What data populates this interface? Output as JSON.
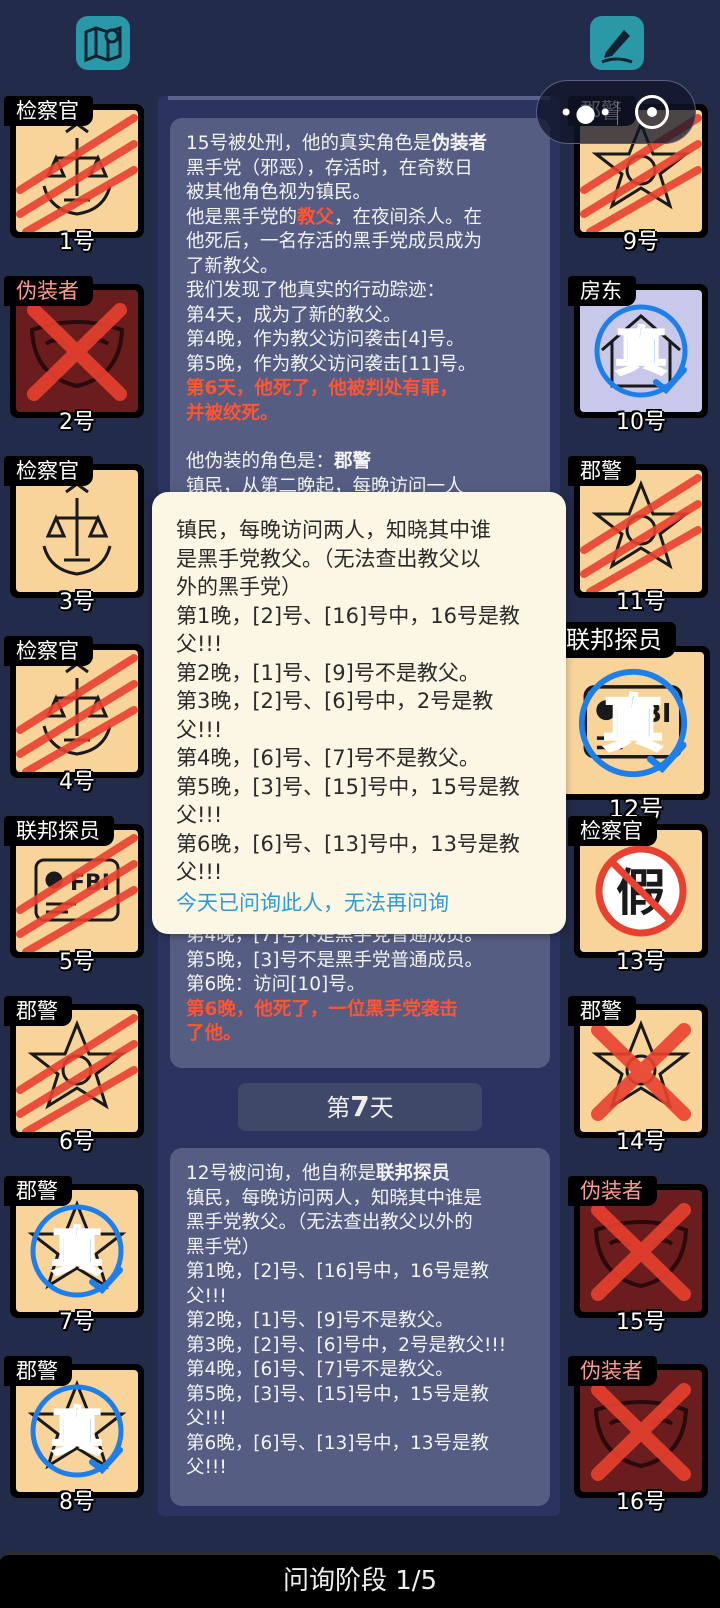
{
  "top": {
    "left_icon": "map-icon",
    "right_icon": "pen-icon"
  },
  "capsule": {
    "menu_icon": "more-dots-icon",
    "close_icon": "target-icon"
  },
  "players_left": [
    {
      "role": "检察官",
      "num": "1号",
      "state": "clawed",
      "emblem": "scales"
    },
    {
      "role": "伪装者",
      "num": "2号",
      "state": "dead-fake",
      "emblem": "mask"
    },
    {
      "role": "检察官",
      "num": "3号",
      "state": "alive",
      "emblem": "scales"
    },
    {
      "role": "检察官",
      "num": "4号",
      "state": "clawed",
      "emblem": "scales"
    },
    {
      "role": "联邦探员",
      "num": "5号",
      "state": "clawed",
      "emblem": "fbi"
    },
    {
      "role": "郡警",
      "num": "6号",
      "state": "clawed",
      "emblem": "star"
    },
    {
      "role": "郡警",
      "num": "7号",
      "state": "true",
      "emblem": "star"
    },
    {
      "role": "郡警",
      "num": "8号",
      "state": "true",
      "emblem": "star"
    }
  ],
  "players_right": [
    {
      "role": "郡警",
      "num": "9号",
      "state": "clawed",
      "emblem": "star"
    },
    {
      "role": "房东",
      "num": "10号",
      "state": "true-lav",
      "emblem": "house"
    },
    {
      "role": "郡警",
      "num": "11号",
      "state": "clawed",
      "emblem": "star"
    },
    {
      "role": "联邦探员",
      "num": "12号",
      "state": "true-big",
      "emblem": "fbi"
    },
    {
      "role": "检察官",
      "num": "13号",
      "state": "fake",
      "emblem": "scales"
    },
    {
      "role": "郡警",
      "num": "14号",
      "state": "crossed",
      "emblem": "star"
    },
    {
      "role": "伪装者",
      "num": "15号",
      "state": "dead-fake",
      "emblem": "mask"
    },
    {
      "role": "伪装者",
      "num": "16号",
      "state": "dead-fake",
      "emblem": "mask"
    }
  ],
  "log1": {
    "l1a": "15号被处刑，他的真实角色是",
    "l1b": "伪装者",
    "l2": "黑手党（邪恶），存活时，在奇数日",
    "l3": "被其他角色视为镇民。",
    "l4a": "他是黑手党的",
    "l4b": "教父",
    "l4c": "，在夜间杀人。在",
    "l5": "他死后，一名存活的黑手党成员成为",
    "l6": "了新教父。",
    "l7": "我们发现了他真实的行动踪迹：",
    "l8": "第4天，成为了新的教父。",
    "l9": "第4晚，作为教父访问袭击[4]号。",
    "l10": "第5晚，作为教父访问袭击[11]号。",
    "l11": "第6天，他死了，他被判处有罪，",
    "l12": "并被绞死。",
    "l13a": "他伪装的角色是：",
    "l13b": "郡警",
    "l14": "镇民，从第二晚起，每晚访问一人",
    "b1": "第4晚，[7]号不是黑手党普通成员。",
    "b2": "第5晚，[3]号不是黑手党普通成员。",
    "b3": "第6晚：访问[10]号。",
    "b4": "第6晚，他死了，一位黑手党袭击",
    "b5": "了他。"
  },
  "day": {
    "prefix": "第",
    "num": "7",
    "suffix": "天"
  },
  "log2": {
    "l1a": "12号被问询，他自称是",
    "l1b": "联邦探员",
    "lines": [
      "镇民，每晚访问两人，知晓其中谁是",
      "黑手党教父。（无法查出教父以外的",
      "黑手党）",
      "第1晚，[2]号、[16]号中，16号是教",
      "父!!!",
      "第2晚，[1]号、[9]号不是教父。",
      "第3晚，[2]号、[6]号中，2号是教父!!!",
      "第4晚，[6]号、[7]号不是教父。",
      "第5晚，[3]号、[15]号中，15号是教",
      "父!!!",
      "第6晚，[6]号、[13]号中，13号是教",
      "父!!!"
    ]
  },
  "popup": {
    "lines": [
      "镇民，每晚访问两人，知晓其中谁",
      "是黑手党教父。（无法查出教父以",
      "外的黑手党）",
      "第1晚，[2]号、[16]号中，16号是教",
      "父!!!",
      "第2晚，[1]号、[9]号不是教父。",
      "第3晚，[2]号、[6]号中，2号是教",
      "父!!!",
      "第4晚，[6]号、[7]号不是教父。",
      "第5晚，[3]号、[15]号中，15号是教",
      "父!!!",
      "第6晚，[6]号、[13]号中，13号是教",
      "父!!!"
    ],
    "note": "今天已问询此人，无法再问询"
  },
  "bottom": {
    "label": "问询阶段 1/5"
  },
  "colors": {
    "bg": "#232b4a",
    "card": "#f8d49b",
    "claw": "#e8412f",
    "true_blue": "#1e7fe8"
  }
}
